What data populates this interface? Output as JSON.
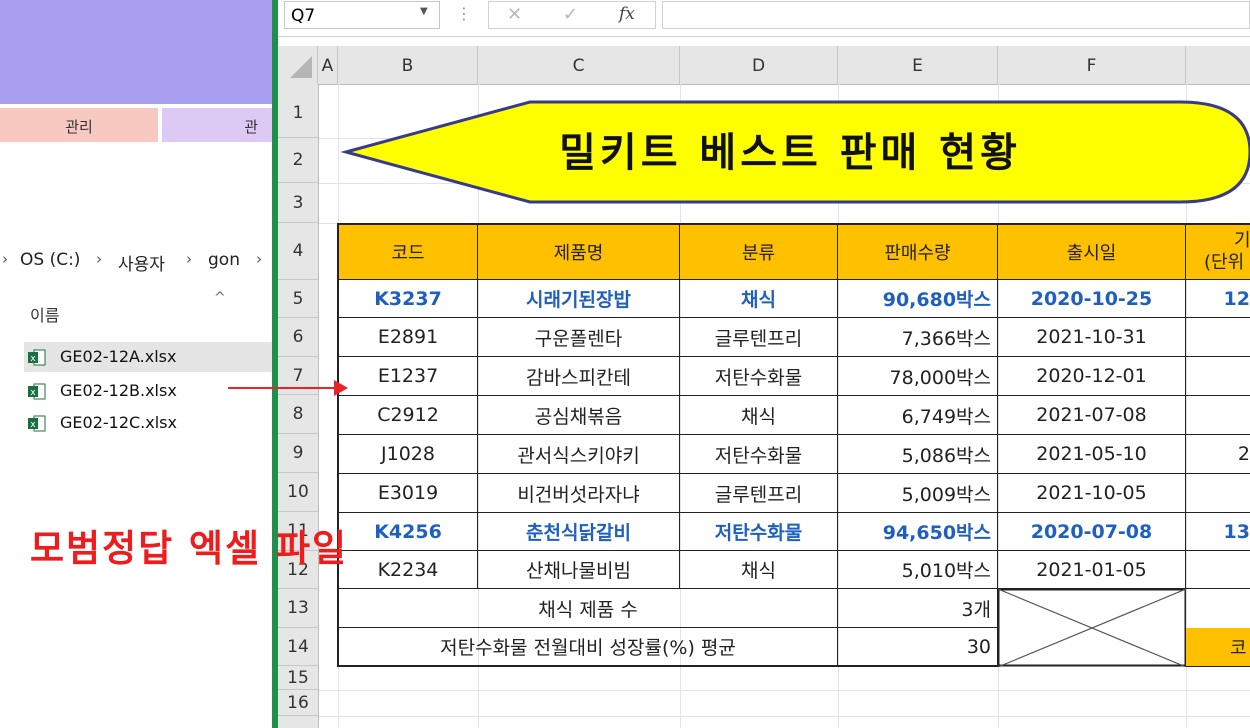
{
  "explorer": {
    "ribbon_tabs": [
      "관리",
      "관"
    ],
    "breadcrumb": [
      "OS (C:)",
      "사용자",
      "gon"
    ],
    "column_header": "이름",
    "files": [
      {
        "name": "GE02-12A.xlsx",
        "selected": true
      },
      {
        "name": "GE02-12B.xlsx",
        "selected": false
      },
      {
        "name": "GE02-12C.xlsx",
        "selected": false
      }
    ]
  },
  "excel": {
    "name_box": "Q7",
    "formula_icons": {
      "cancel": "✕",
      "enter": "✓",
      "fx": "fx"
    },
    "columns": [
      "A",
      "B",
      "C",
      "D",
      "E",
      "F"
    ],
    "rows": [
      "1",
      "2",
      "3",
      "4",
      "5",
      "6",
      "7",
      "8",
      "9",
      "10",
      "11",
      "12",
      "13",
      "14",
      "15",
      "16"
    ],
    "title": "밀키트 베스트 판매 현황",
    "table": {
      "headers": [
        "코드",
        "제품명",
        "분류",
        "판매수량",
        "출시일"
      ],
      "partial_header_top": "기",
      "partial_header_bottom": "(단위",
      "rows": [
        {
          "code": "K3237",
          "name": "시래기된장밥",
          "category": "채식",
          "qty": "90,680박스",
          "date": "2020-10-25",
          "partial": "12",
          "highlight": true
        },
        {
          "code": "E2891",
          "name": "구운폴렌타",
          "category": "글루텐프리",
          "qty": "7,366박스",
          "date": "2021-10-31",
          "partial": "",
          "highlight": false
        },
        {
          "code": "E1237",
          "name": "감바스피칸테",
          "category": "저탄수화물",
          "qty": "78,000박스",
          "date": "2020-12-01",
          "partial": "",
          "highlight": false
        },
        {
          "code": "C2912",
          "name": "공심채볶음",
          "category": "채식",
          "qty": "6,749박스",
          "date": "2021-07-08",
          "partial": "",
          "highlight": false
        },
        {
          "code": "J1028",
          "name": "관서식스키야키",
          "category": "저탄수화물",
          "qty": "5,086박스",
          "date": "2021-05-10",
          "partial": "2",
          "highlight": false
        },
        {
          "code": "E3019",
          "name": "비건버섯라자냐",
          "category": "글루텐프리",
          "qty": "5,009박스",
          "date": "2021-10-05",
          "partial": "",
          "highlight": false
        },
        {
          "code": "K4256",
          "name": "춘천식닭갈비",
          "category": "저탄수화물",
          "qty": "94,650박스",
          "date": "2020-07-08",
          "partial": "13",
          "highlight": true
        },
        {
          "code": "K2234",
          "name": "산채나물비빔",
          "category": "채식",
          "qty": "5,010박스",
          "date": "2021-01-05",
          "partial": "",
          "highlight": false
        }
      ],
      "summary": [
        {
          "label": "채식 제품 수",
          "value": "3개"
        },
        {
          "label": "저탄수화물 전월대비 성장률(%) 평균",
          "value": "30"
        }
      ],
      "partial_summary_cell": "코"
    }
  },
  "overlay_label": "모범정답 엑셀 파일",
  "colors": {
    "header_fill": "#ffc000",
    "title_fill": "#ffff00",
    "highlight_text": "#1f5fbf",
    "overlay_text": "#ee1c1c",
    "ribbon": "#a79ef0"
  }
}
